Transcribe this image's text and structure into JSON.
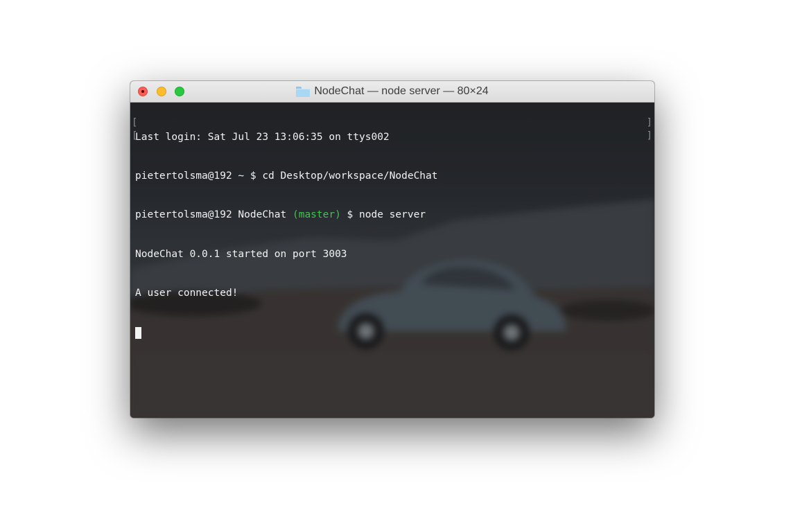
{
  "window": {
    "title": "NodeChat — node server — 80×24",
    "title_icon": "folder-icon",
    "buttons": {
      "close": "close-button",
      "minimize": "minimize-button",
      "zoom": "zoom-button"
    }
  },
  "terminal": {
    "lines": [
      {
        "text": "Last login: Sat Jul 23 13:06:35 on ttys002"
      },
      {
        "text": "pietertolsma@192 ~ $ cd Desktop/workspace/NodeChat"
      },
      {
        "prefix": "pietertolsma@192 NodeChat ",
        "branch": "(master)",
        "suffix": " $ node server"
      },
      {
        "text": "NodeChat 0.0.1 started on port 3003"
      },
      {
        "text": "A user connected!"
      }
    ],
    "mark_open": "[",
    "mark_close": "]"
  },
  "colors": {
    "branch": "#3fc34f",
    "close": "#fc5f57",
    "minimize": "#fdbc2e",
    "zoom": "#29c840"
  }
}
